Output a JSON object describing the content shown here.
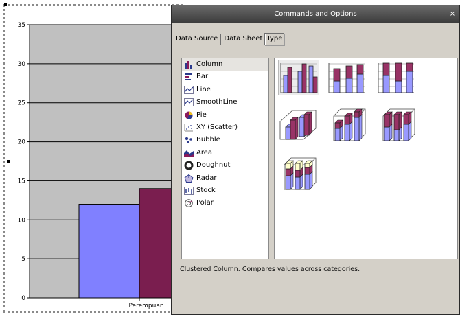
{
  "chart_data": {
    "type": "bar",
    "categories": [
      "Perempuan"
    ],
    "series": [
      {
        "values": [
          12
        ],
        "color": "#8080ff"
      },
      {
        "values": [
          14
        ],
        "color": "#7a1e4f"
      }
    ],
    "ylim": [
      0,
      35
    ],
    "yticks": [
      "0",
      "5",
      "10",
      "15",
      "20",
      "25",
      "30",
      "35"
    ],
    "grid": true,
    "background": "#c0c0c0"
  },
  "panel": {
    "title": "Commands and Options",
    "close_label": "×",
    "tabs": [
      "Data Source",
      "Data Sheet",
      "Type"
    ],
    "active_tab": "Type",
    "chart_types": [
      {
        "label": "Column",
        "icon": "column-chart-icon"
      },
      {
        "label": "Bar",
        "icon": "bar-chart-icon"
      },
      {
        "label": "Line",
        "icon": "line-chart-icon"
      },
      {
        "label": "SmoothLine",
        "icon": "smoothline-chart-icon"
      },
      {
        "label": "Pie",
        "icon": "pie-chart-icon"
      },
      {
        "label": "XY (Scatter)",
        "icon": "scatter-chart-icon"
      },
      {
        "label": "Bubble",
        "icon": "bubble-chart-icon"
      },
      {
        "label": "Area",
        "icon": "area-chart-icon"
      },
      {
        "label": "Doughnut",
        "icon": "doughnut-chart-icon"
      },
      {
        "label": "Radar",
        "icon": "radar-chart-icon"
      },
      {
        "label": "Stock",
        "icon": "stock-chart-icon"
      },
      {
        "label": "Polar",
        "icon": "polar-chart-icon"
      }
    ],
    "selected_type": "Column",
    "subtypes": [
      {
        "name": "clustered-column",
        "kind": "clustered"
      },
      {
        "name": "stacked-column",
        "kind": "stacked"
      },
      {
        "name": "100-stacked-column",
        "kind": "stacked100"
      },
      {
        "name": "3d-clustered-column",
        "kind": "clustered3d"
      },
      {
        "name": "3d-stacked-column",
        "kind": "stacked3d"
      },
      {
        "name": "3d-100-stacked-column",
        "kind": "stacked1003d"
      },
      {
        "name": "3d-column",
        "kind": "column3d"
      }
    ],
    "description": "Clustered Column. Compares values across categories.",
    "colors": {
      "blue": "#9999ff",
      "maroon": "#993366",
      "cream": "#ffffcc"
    }
  }
}
